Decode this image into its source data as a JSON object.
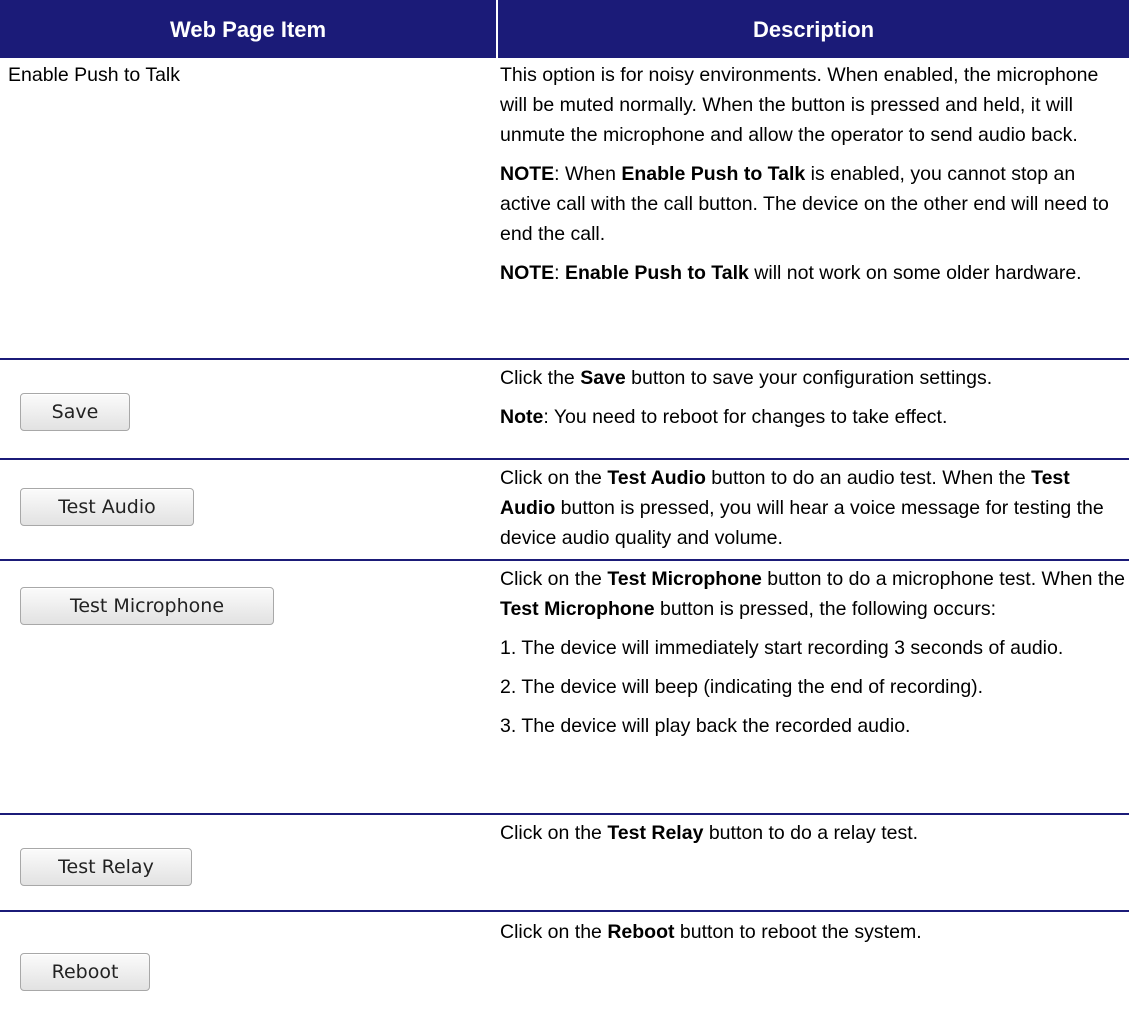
{
  "header": {
    "col1": "Web Page Item",
    "col2": "Description"
  },
  "rows": {
    "push_to_talk": {
      "item": "Enable Push to Talk",
      "p1": "This option is for noisy environments. When enabled, the microphone will be muted normally. When the button is pressed and held, it will unmute the microphone and allow the operator to send audio back.",
      "note1_label": "NOTE",
      "note1_a": ": When ",
      "note1_b": "Enable Push to Talk",
      "note1_c": " is enabled, you cannot stop an active call with the call button. The device on the other end will need to end the call.",
      "note2_label": "NOTE",
      "note2_a": ": ",
      "note2_b": "Enable Push to Talk",
      "note2_c": " will not work on some older hardware."
    },
    "save": {
      "button_label": "Save",
      "a": "Click the ",
      "b": "Save",
      "c": " button to save your configuration settings.",
      "note_label": "Note",
      "note_text": ": You need to reboot for changes to take effect."
    },
    "test_audio": {
      "button_label": "Test Audio",
      "a": "Click on the ",
      "b": "Test Audio",
      "c": " button to do an audio test. When the ",
      "d": "Test Audio",
      "e": " button is pressed, you will hear a voice message for testing the device audio quality and volume."
    },
    "test_microphone": {
      "button_label": "Test Microphone",
      "a": "Click on the ",
      "b": "Test Microphone",
      "c": " button to do a microphone test. When the ",
      "d": "Test Microphone",
      "e": " button is pressed, the following occurs:",
      "step1": "1. The device will immediately start recording 3 seconds of audio.",
      "step2": "2. The device will beep (indicating the end of recording).",
      "step3": "3. The device will play back the recorded audio."
    },
    "test_relay": {
      "button_label": "Test Relay",
      "a": "Click on the ",
      "b": "Test Relay",
      "c": " button to do a relay test."
    },
    "reboot": {
      "button_label": "Reboot",
      "a": "Click on the ",
      "b": "Reboot",
      "c": " button to reboot the system."
    }
  },
  "colors": {
    "header_bg": "#1b1b78",
    "rule": "#1b1b78"
  }
}
